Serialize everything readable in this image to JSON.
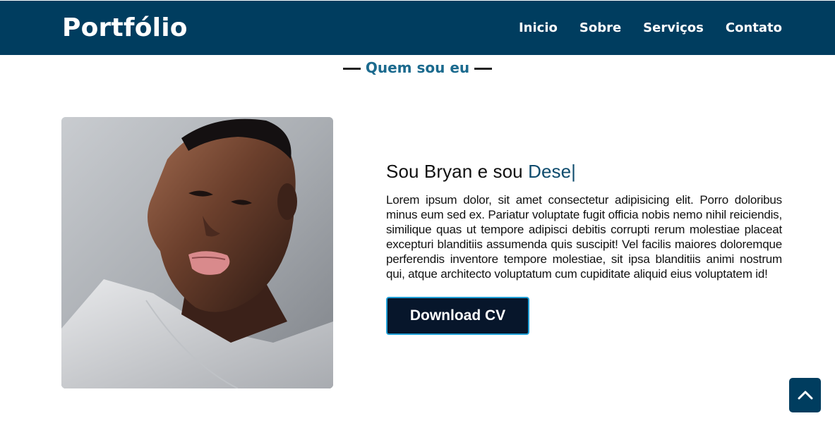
{
  "header": {
    "brand": "Portfólio",
    "nav": [
      {
        "label": "Inicio"
      },
      {
        "label": "Sobre"
      },
      {
        "label": "Serviços"
      },
      {
        "label": "Contato"
      }
    ]
  },
  "section": {
    "title": "Quem sou eu"
  },
  "about": {
    "heading_prefix": "Sou Bryan e sou ",
    "heading_role": "Dese",
    "heading_cursor": "|",
    "paragraph": "Lorem ipsum dolor, sit amet consectetur adipisicing elit. Porro doloribus minus eum sed ex. Pariatur voluptate fugit officia nobis nemo nihil reiciendis, similique quas ut tempore adipisci debitis corrupti rerum molestiae placeat excepturi blanditiis assumenda quis suscipit! Vel facilis maiores doloremque perferendis inventore tempore molestiae, sit ipsa blanditiis animi nostrum qui, atque architecto voluptatum cum cupiditate aliquid eius voluptatem id!",
    "button_label": "Download CV"
  },
  "icons": {
    "back_to_top": "chevron-up-icon"
  },
  "colors": {
    "header_bg": "#003d5f",
    "accent": "#0f4c6e",
    "title": "#1b6a8e",
    "button_bg": "#07162b",
    "button_border": "#1f9fd6"
  }
}
